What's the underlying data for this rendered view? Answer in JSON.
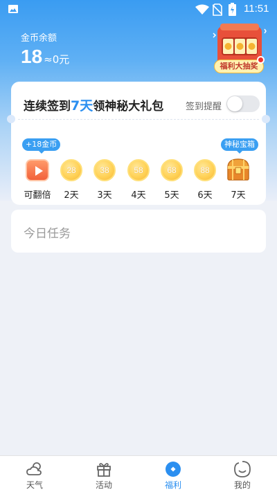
{
  "status_bar": {
    "time": "11:51"
  },
  "wallet": {
    "label": "金币余额",
    "coins": "18",
    "cash_equiv": "≈0元"
  },
  "lottery": {
    "label": "福利大抽奖"
  },
  "signin": {
    "title_prefix": "连续签到",
    "title_highlight": "7天",
    "title_suffix": "领神秘大礼包",
    "remind_label": "签到提醒",
    "remind_on": false,
    "days": [
      {
        "label": "可翻倍",
        "reward": "",
        "bubble": "+18金币",
        "type": "video"
      },
      {
        "label": "2天",
        "reward": "28",
        "type": "coin"
      },
      {
        "label": "3天",
        "reward": "38",
        "type": "coin"
      },
      {
        "label": "4天",
        "reward": "58",
        "type": "coin"
      },
      {
        "label": "5天",
        "reward": "68",
        "type": "coin"
      },
      {
        "label": "6天",
        "reward": "88",
        "type": "coin"
      },
      {
        "label": "7天",
        "reward": "",
        "bubble": "神秘宝箱",
        "type": "chest"
      }
    ]
  },
  "tasks": {
    "title": "今日任务"
  },
  "tabbar": {
    "items": [
      {
        "label": "天气",
        "icon": "weather-icon"
      },
      {
        "label": "活动",
        "icon": "gift-icon"
      },
      {
        "label": "福利",
        "icon": "welfare-icon",
        "active": true
      },
      {
        "label": "我的",
        "icon": "profile-icon"
      }
    ]
  },
  "colors": {
    "accent": "#2b8ff0",
    "coin": "#ffd258",
    "header": "#3a9cf2"
  }
}
